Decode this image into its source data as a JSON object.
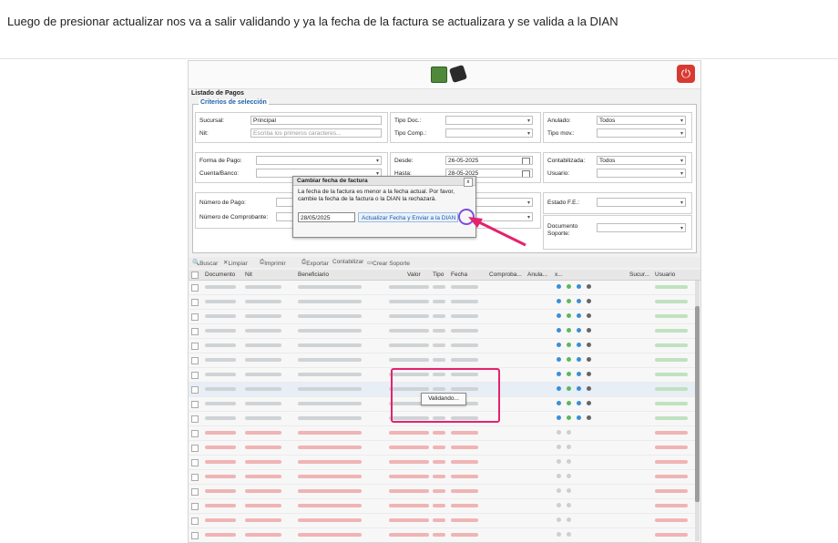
{
  "caption": "Luego de presionar actualizar nos va a salir validando y ya la fecha de la factura se actualizara y se valida a la DIAN",
  "app": {
    "panel_title": "Listado de Pagos",
    "criteria_title": "Criterios de selección",
    "icons": [
      "money-icon",
      "check-icon",
      "power-icon"
    ],
    "power_glyph": "⏻"
  },
  "filters": {
    "sucursal_label": "Sucursal:",
    "sucursal_value": "Principal",
    "nit_label": "Nit:",
    "nit_placeholder": "Escriba los primeros caracteres...",
    "tipo_doc_label": "Tipo Doc.:",
    "tipo_comp_label": "Tipo Comp.:",
    "anulado_label": "Anulado:",
    "anulado_value": "Todos",
    "tipo_mov_label": "Tipo mov.:",
    "forma_pago_label": "Forma de Pago:",
    "cuenta_banco_label": "Cuenta/Banco:",
    "desde_label": "Desde:",
    "desde_value": "26-05-2025",
    "hasta_label": "Hasta:",
    "hasta_value": "28-05-2025",
    "contabilizada_label": "Contabilizada:",
    "contabilizada_value": "Todos",
    "usuario_label": "Usuario:",
    "numero_pago_label": "Número de Pago:",
    "numero_comprobante_label": "Número de Comprobante:",
    "estado_fe_label": "Estado F.E.:",
    "documento_soporte_label": "Documento Soporte:"
  },
  "toolbar": {
    "buscar": "Buscar",
    "limpiar": "Limpiar",
    "imprimir": "Imprimir",
    "exportar": "Exportar",
    "contabilizar": "Contabilizar",
    "crear_soporte": "Crear Soporte"
  },
  "grid": {
    "columns": [
      "Documento",
      "Nit",
      "Beneficiario",
      "Valor",
      "Tipo",
      "Fecha",
      "Comproba...",
      "Anula...",
      "x...",
      "Sucur...",
      "Usuario"
    ]
  },
  "dialog": {
    "title": "Cambiar fecha de factura",
    "close_glyph": "x",
    "message": "La fecha de la factura es menor a la fecha actual. Por favor, cambie la fecha de la factura o la DIAN la rechazará.",
    "date_value": "28/05/2025",
    "button_label": "Actualizar Fecha y Enviar a la DIAN"
  },
  "status": {
    "validando": "Validando..."
  }
}
